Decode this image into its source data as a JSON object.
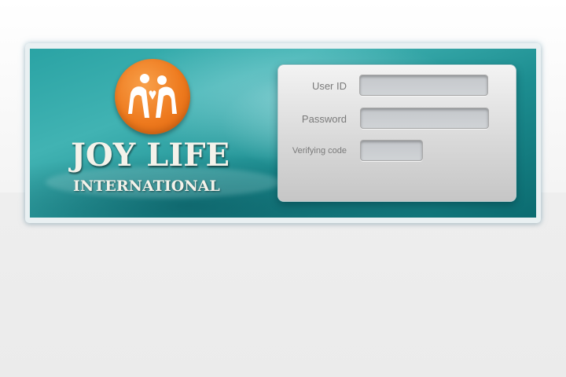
{
  "brand": {
    "logo_icon": "joy-life-logo-icon",
    "title": "JOY LIFE",
    "subtitle": "INTERNATIONAL"
  },
  "login": {
    "user_id_label": "User ID",
    "user_id_value": "",
    "password_label": "Password",
    "password_value": "",
    "verify_label": "Verifying code",
    "verify_value": ""
  },
  "colors": {
    "banner_teal": "#2aa3a4",
    "logo_orange": "#ee7a1e",
    "panel_gray": "#d9d9d9"
  }
}
